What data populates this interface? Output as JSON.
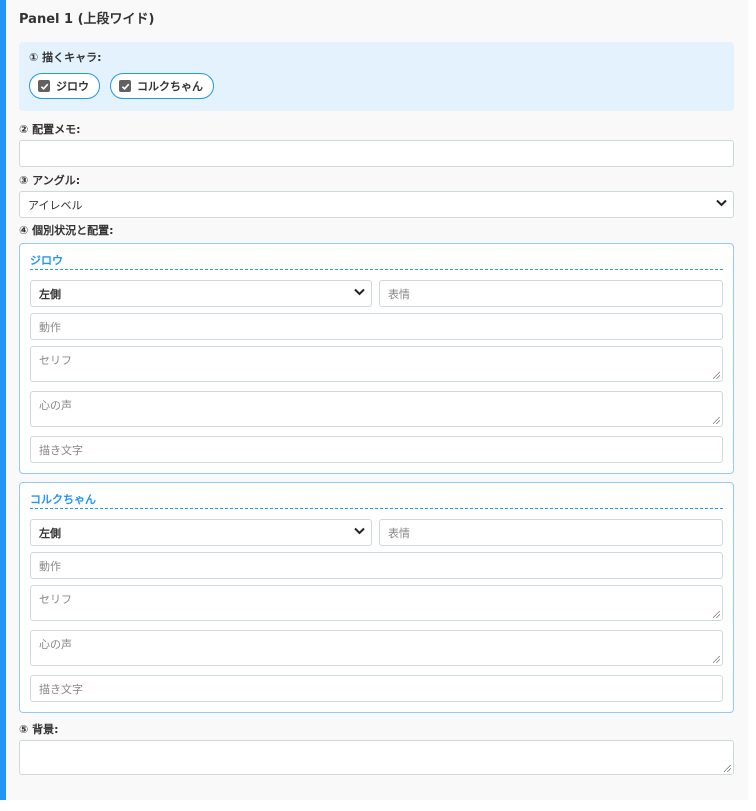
{
  "panel": {
    "title": "Panel 1 (上段ワイド)"
  },
  "characters_section": {
    "label": "① 描くキャラ:",
    "chips": [
      {
        "label": "ジロウ",
        "checked": true
      },
      {
        "label": "コルクちゃん",
        "checked": true
      }
    ]
  },
  "layout_memo": {
    "label": "② 配置メモ:",
    "value": ""
  },
  "angle": {
    "label": "③ アングル:",
    "selected": "アイレベル"
  },
  "individual": {
    "label": "④ 個別状況と配置:",
    "cards": [
      {
        "name": "ジロウ",
        "position": "左側",
        "expression_placeholder": "表情",
        "action_placeholder": "動作",
        "dialogue_placeholder": "セリフ",
        "inner_voice_placeholder": "心の声",
        "sfx_placeholder": "描き文字"
      },
      {
        "name": "コルクちゃん",
        "position": "左側",
        "expression_placeholder": "表情",
        "action_placeholder": "動作",
        "dialogue_placeholder": "セリフ",
        "inner_voice_placeholder": "心の声",
        "sfx_placeholder": "描き文字"
      }
    ]
  },
  "background": {
    "label": "⑤ 背景:",
    "value": ""
  }
}
